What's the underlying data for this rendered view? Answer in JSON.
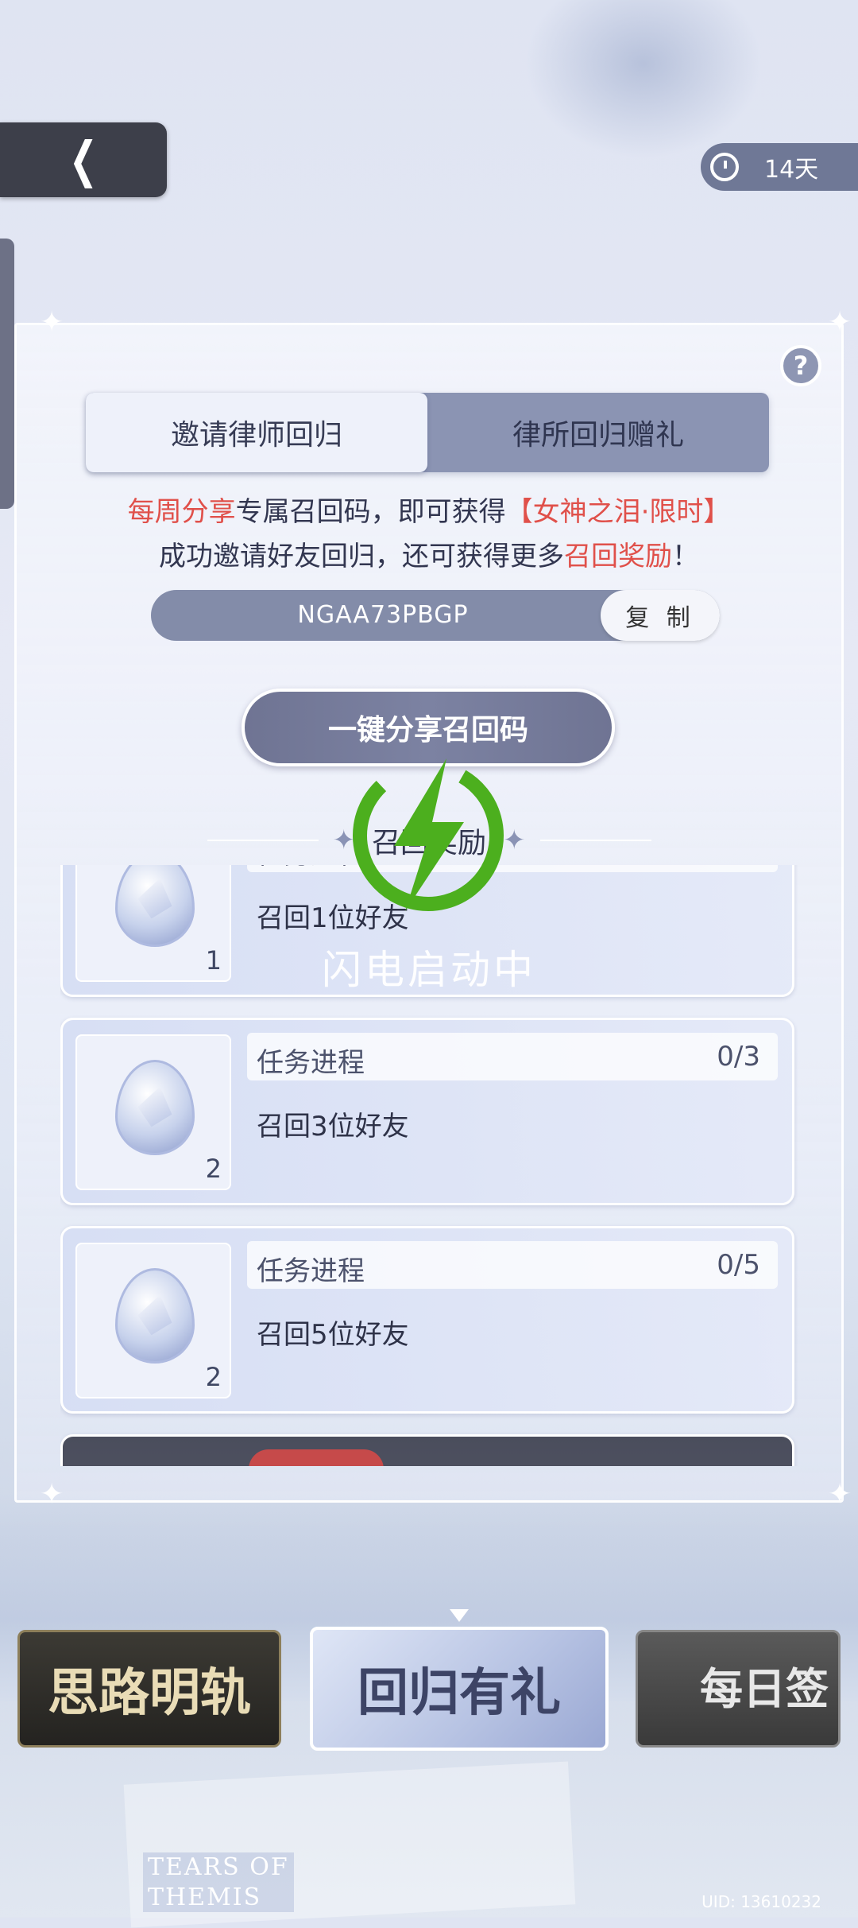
{
  "header": {
    "back_icon": "chevron-left-icon",
    "timer_icon": "clock-icon",
    "timer_text": "14天"
  },
  "help_icon": "question-icon",
  "help_glyph": "?",
  "tabs": [
    {
      "label": "邀请律师回归",
      "active": true
    },
    {
      "label": "律所回归赠礼",
      "active": false
    }
  ],
  "intro": {
    "line1_red1": "每周分享",
    "line1_mid": "专属召回码，即可获得",
    "line1_red2": "【女神之泪·限时】",
    "line2_pre": "成功邀请好友回归，还可获得更多",
    "line2_red": "召回奖励",
    "line2_post": "！"
  },
  "invite_code": {
    "code": "NGAA73PBGP",
    "copy_label": "复 制"
  },
  "share_button": "一键分享召回码",
  "rewards_title": "召回奖励",
  "overlay": {
    "loading_text": "闪电启动中",
    "icon": "lightning-bolt-icon"
  },
  "tasks": [
    {
      "progress_label": "任务进程",
      "progress_value": "",
      "desc": "召回1位好友",
      "reward_qty": "1",
      "reward_icon": "goddess-tear-gem-icon"
    },
    {
      "progress_label": "任务进程",
      "progress_value": "0/3",
      "desc": "召回3位好友",
      "reward_qty": "2",
      "reward_icon": "goddess-tear-gem-icon"
    },
    {
      "progress_label": "任务进程",
      "progress_value": "0/5",
      "desc": "召回5位好友",
      "reward_qty": "2",
      "reward_icon": "goddess-tear-gem-icon"
    }
  ],
  "carousel": [
    {
      "label": "思路明轨"
    },
    {
      "label": "回归有礼"
    },
    {
      "label": "每日签"
    }
  ],
  "footer": {
    "logo_line1": "TEARS OF",
    "logo_line2": "THEMIS",
    "uid": "UID: 13610232"
  },
  "colors": {
    "accent_red": "#e0504a",
    "tab_bar": "#8b94b3",
    "bolt_green": "#4caf1e"
  }
}
